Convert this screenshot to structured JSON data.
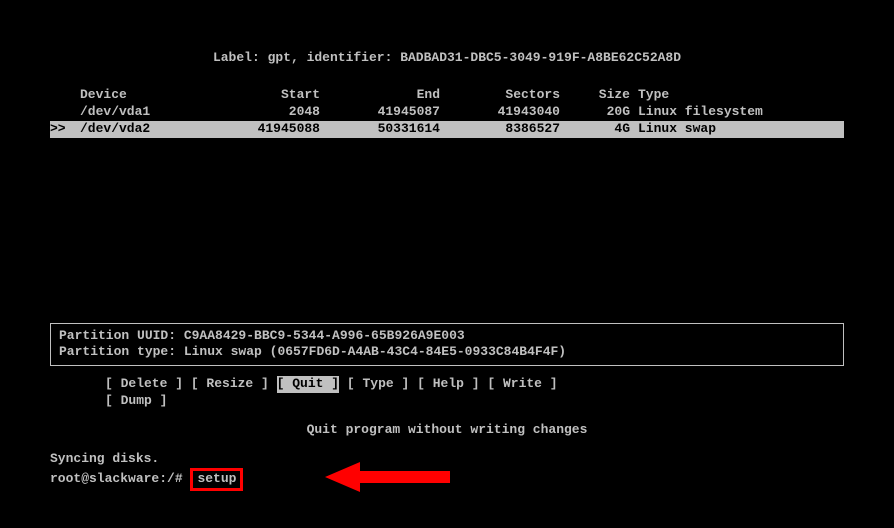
{
  "label": {
    "prefix": "Label: ",
    "scheme": "gpt",
    "id_prefix": ", identifier: ",
    "identifier": "BADBAD31-DBC5-3049-919F-A8BE62C52A8D"
  },
  "headers": {
    "device": "Device",
    "start": "Start",
    "end": "End",
    "sectors": "Sectors",
    "size": "Size",
    "type": "Type"
  },
  "partitions": [
    {
      "marker": "   ",
      "device": "/dev/vda1",
      "start": "2048",
      "end": "41945087",
      "sectors": "41943040",
      "size": "20G",
      "type": "Linux filesystem",
      "selected": false
    },
    {
      "marker": ">> ",
      "device": "/dev/vda2",
      "start": "41945088",
      "end": "50331614",
      "sectors": "8386527",
      "size": "4G",
      "type": "Linux swap",
      "selected": true
    }
  ],
  "info": {
    "uuid_label": "Partition UUID: ",
    "uuid": "C9AA8429-BBC9-5344-A996-65B926A9E003",
    "type_label": "Partition type: ",
    "type_name": "Linux swap",
    "type_guid": " (0657FD6D-A4AB-43C4-84E5-0933C84B4F4F)"
  },
  "actions": {
    "delete": "[ Delete ]",
    "resize": "[ Resize ]",
    "quit": "[  Quit  ]",
    "type": "[  Type  ]",
    "help": "[  Help  ]",
    "write": "[  Write ]",
    "dump": "[  Dump  ]"
  },
  "quit_msg": "Quit program without writing changes",
  "sync_msg": "Syncing disks.",
  "prompt": "root@slackware:/# ",
  "command": "setup"
}
